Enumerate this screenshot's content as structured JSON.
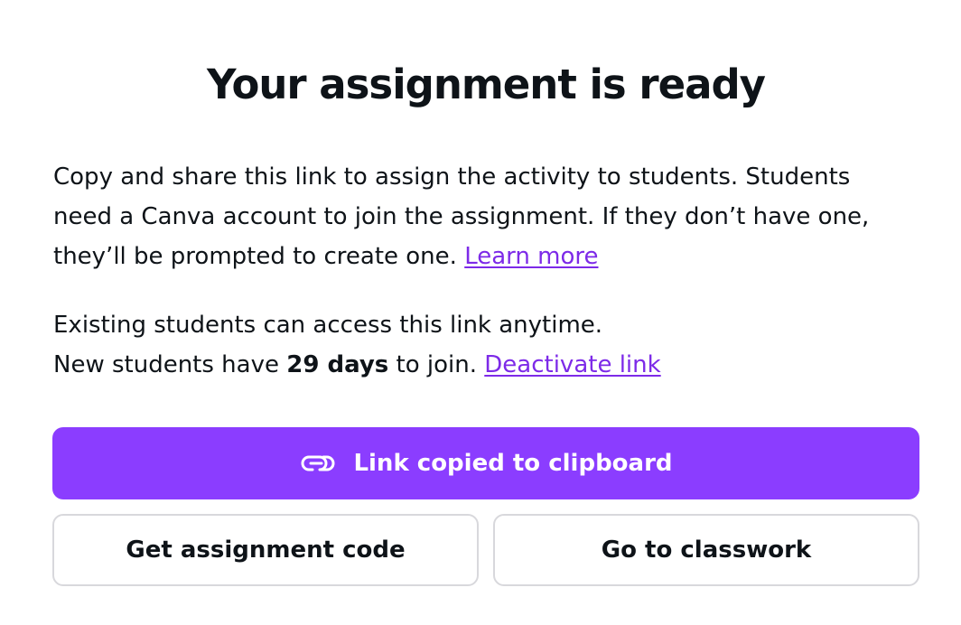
{
  "dialog": {
    "title": "Your assignment is ready",
    "description": "Copy and share this link to assign the activity to students. Students need a Canva account to join the assignment. If they don’t have one, they’ll be prompted to create one.",
    "learn_more_label": "Learn more",
    "access_line": "Existing students can access this link anytime.",
    "join_prefix": "New students have",
    "join_days": "29 days",
    "join_suffix": "to join.",
    "deactivate_label": "Deactivate link"
  },
  "buttons": {
    "copy_link_label": "Link copied to clipboard",
    "copy_link_icon": "link-icon",
    "assignment_code_label": "Get assignment code",
    "classwork_label": "Go to classwork"
  },
  "colors": {
    "accent": "#8b3dff",
    "link": "#7d2ae8",
    "text": "#0e1318",
    "border": "#d8d8dc"
  }
}
